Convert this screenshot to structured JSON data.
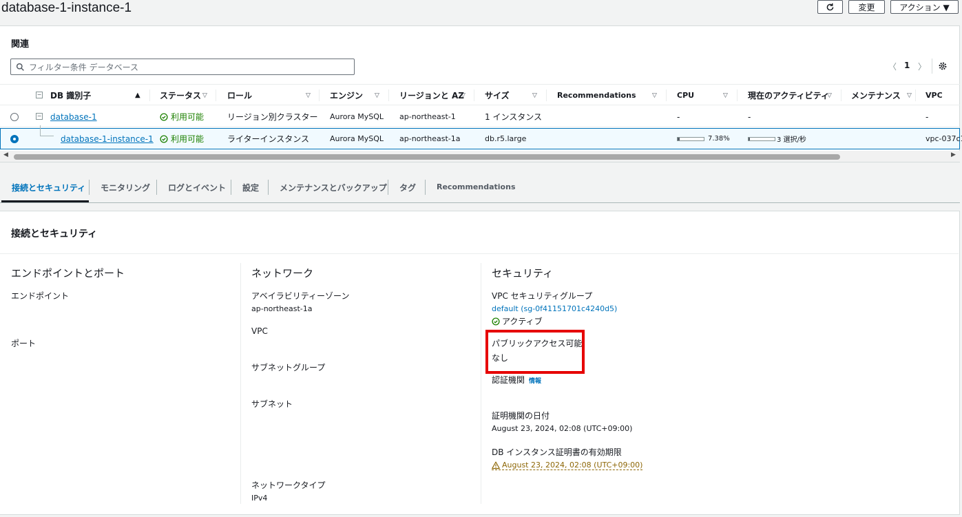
{
  "header": {
    "title": "database-1-instance-1",
    "modify_label": "変更",
    "actions_label": "アクション ▼"
  },
  "related": {
    "title": "関連",
    "search_placeholder": "フィルター条件 データベース",
    "page_number": "1",
    "columns": [
      "DB 識別子",
      "ステータス",
      "ロール",
      "エンジン",
      "リージョンと AZ",
      "サイズ",
      "Recommendations",
      "CPU",
      "現在のアクティビティ",
      "メンテナンス",
      "VPC"
    ],
    "rows": [
      {
        "id": "database-1",
        "status": "利用可能",
        "role": "リージョン別クラスター",
        "engine": "Aurora MySQL",
        "region": "ap-northeast-1",
        "size": "1 インスタンス",
        "cpu": "-",
        "activity": "-",
        "vpc": "-"
      },
      {
        "id": "database-1-instance-1",
        "status": "利用可能",
        "role": "ライターインスタンス",
        "engine": "Aurora MySQL",
        "region": "ap-northeast-1a",
        "size": "db.r5.large",
        "cpu": "7.38%",
        "cpu_fraction": 0.0738,
        "activity": "3 選択/秒",
        "activity_fraction": 0.05,
        "vpc": "vpc-037c1"
      }
    ]
  },
  "tabs": [
    "接続とセキュリティ",
    "モニタリング",
    "ログとイベント",
    "設定",
    "メンテナンスとバックアップ",
    "タグ",
    "Recommendations"
  ],
  "connectivity": {
    "title": "接続とセキュリティ",
    "endpoints": {
      "heading": "エンドポイントとポート",
      "endpoint_label": "エンドポイント",
      "port_label": "ポート"
    },
    "network": {
      "heading": "ネットワーク",
      "az_label": "アベイラビリティーゾーン",
      "az_value": "ap-northeast-1a",
      "vpc_label": "VPC",
      "subnet_group_label": "サブネットグループ",
      "subnet_label": "サブネット",
      "network_type_label": "ネットワークタイプ",
      "network_type_value": "IPv4"
    },
    "security": {
      "heading": "セキュリティ",
      "sg_label": "VPC セキュリティグループ",
      "sg_value": "default (sg-0f41151701c4240d5)",
      "sg_status": "アクティブ",
      "public_label": "パブリックアクセス可能",
      "public_value": "なし",
      "ca_label": "認証機関",
      "info_label": "情報",
      "ca_date_label": "証明機関の日付",
      "ca_date_value": "August 23, 2024, 02:08 (UTC+09:00)",
      "cert_expiry_label": "DB インスタンス証明書の有効期限",
      "cert_expiry_value": "August 23, 2024, 02:08 (UTC+09:00)"
    }
  },
  "colors": {
    "link": "#0073bb",
    "success": "#1d8102",
    "warning": "#8d6605",
    "highlight": "#e60000"
  }
}
